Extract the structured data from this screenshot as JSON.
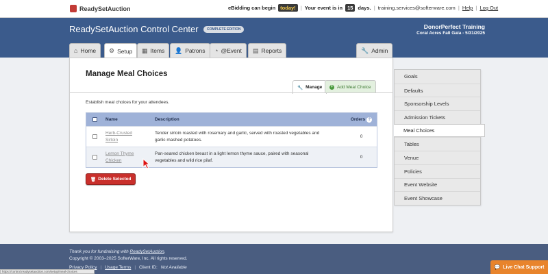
{
  "topbar": {
    "logo_text": "ReadySetAuction",
    "ebidding_prefix": "eBidding can begin",
    "ebidding_today": "today!",
    "event_prefix": "Your event is in",
    "event_days": "15",
    "event_suffix": "days.",
    "email": "training.services@softerware.com",
    "help_label": "Help",
    "logout_label": "Log Out"
  },
  "header": {
    "title": "ReadySetAuction Control Center",
    "edition": "COMPLETE EDITION",
    "org_name": "DonorPerfect Training",
    "event_name": "Coral Acres Fall Gala - 5/31/2025"
  },
  "tabs": [
    {
      "label": "Home",
      "icon": "home-icon"
    },
    {
      "label": "Setup",
      "icon": "gear-icon",
      "active": true
    },
    {
      "label": "Items",
      "icon": "items-icon"
    },
    {
      "label": "Patrons",
      "icon": "patrons-icon"
    },
    {
      "label": "@Event",
      "icon": "event-icon"
    },
    {
      "label": "Reports",
      "icon": "reports-icon"
    },
    {
      "label": "Admin",
      "icon": "wrench-icon"
    }
  ],
  "main": {
    "title": "Manage Meal Choices",
    "manage_tab": "Manage",
    "add_tab": "Add Meal Choice",
    "intro": "Establish meal choices for your attendees.",
    "delete_label": "Delete Selected"
  },
  "table": {
    "headers": {
      "name": "Name",
      "description": "Description",
      "orders": "Orders"
    },
    "rows": [
      {
        "name_line1": "Herb-Crusted",
        "name_line2": "Sirloin",
        "desc_line1": "Tender sirloin roasted with rosemary and garlic, served with roasted vegetables and",
        "desc_line2": "garlic mashed potatoes.",
        "orders": "0"
      },
      {
        "name_line1": "Lemon Thyme",
        "name_line2": "Chicken",
        "desc_line1": "Pan-seared chicken breast in a light lemon thyme sauce, paired with seasonal",
        "desc_line2": "vegetables and wild rice pilaf.",
        "orders": "0"
      }
    ]
  },
  "sidenav": {
    "items": [
      "Goals",
      "Defaults",
      "Sponsorship Levels",
      "Admission Tickets",
      "Meal Choices",
      "Tables",
      "Venue",
      "Policies",
      "Event Website",
      "Event Showcase"
    ],
    "active_index": 4
  },
  "footer": {
    "thanks_prefix": "Thank you for fundraising with",
    "thanks_link": "ReadySetAuction",
    "thanks_suffix": ".",
    "copyright": "Copyright © 2003–2025 SofterWare, Inc. All rights reserved.",
    "privacy": "Privacy Policy",
    "usage": "Usage Terms",
    "client_id_label": "Client ID:",
    "client_id_value": "Not Available",
    "status_url": "https://control.readysetauction.com/setup/meal-choices"
  },
  "chat": {
    "label": "Live Chat Support"
  },
  "colors": {
    "header_bg": "#3b5b8c",
    "table_head": "#9fb2d8",
    "delete_red": "#c9302c",
    "chat_orange": "#e8842c",
    "footer_bg": "#4a5d80"
  }
}
